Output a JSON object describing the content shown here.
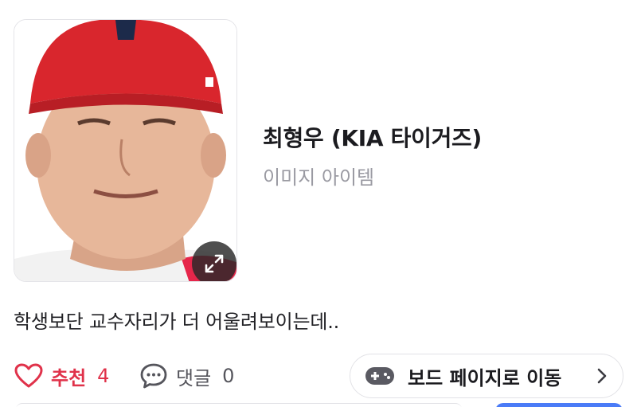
{
  "item": {
    "title": "최형우 (KIA 타이거즈)",
    "subtitle": "이미지 아이템",
    "image_icon": "player-portrait",
    "expand_icon": "expand-arrows-icon"
  },
  "post": {
    "body": "학생보단 교수자리가 더 어울려보이는데.."
  },
  "actions": {
    "like_label": "추천",
    "like_count": "4",
    "comment_label": "댓글",
    "comment_count": "0",
    "board_label": "보드 페이지로 이동"
  },
  "colors": {
    "like_red": "#e0324a",
    "subtitle_gray": "#9a9aa2",
    "accent_blue": "#4a7bf7"
  }
}
